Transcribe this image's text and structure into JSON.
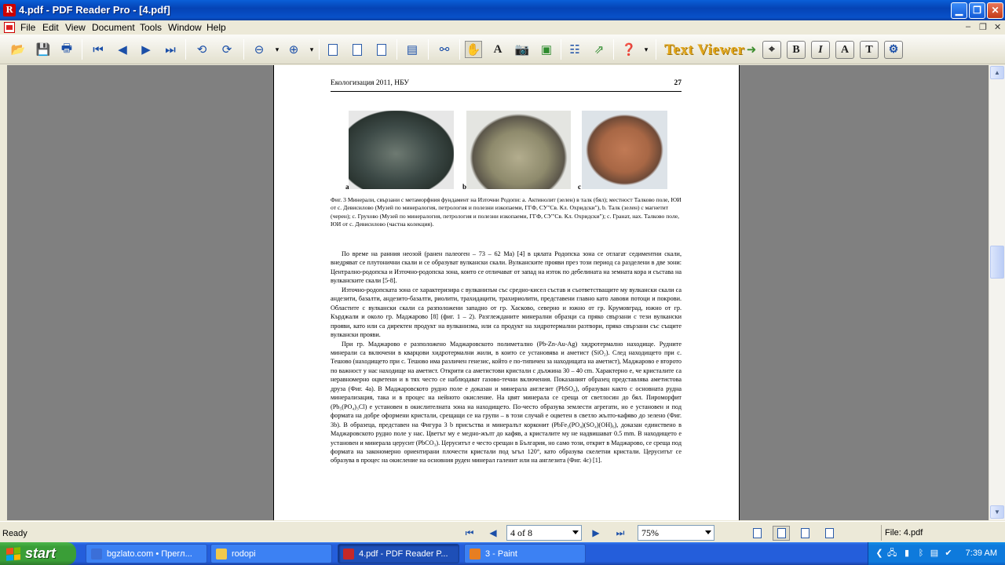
{
  "window": {
    "title": "4.pdf - PDF Reader Pro - [4.pdf]",
    "app_icon_glyph": "R"
  },
  "menu": {
    "items": [
      "File",
      "Edit",
      "View",
      "Document",
      "Tools",
      "Window",
      "Help"
    ],
    "mdi_controls": [
      "–",
      "❐",
      "✕"
    ]
  },
  "toolbar": {
    "text_viewer_label": "Text Viewer",
    "format_buttons": [
      "B",
      "I",
      "A",
      "T"
    ]
  },
  "document": {
    "header_left": "Екологизация 2011, НБУ",
    "header_page": "27",
    "photo_labels": [
      "a",
      "b",
      "c"
    ],
    "caption": "Фиг. 3 Минерали, свързани с метаморфния фундамент на Източни Родопи: а. Актинолит (зелен) в талк (бял); местност Талково поле, ЮИ от с. Девисилово (Музей по минералогия, петрология и полезни изкопаеми, ГГФ, СУ\"Св. Кл. Охридски\"), b. Талк (зелен) с магнетит (черен); с. Грухово (Музей по минералогия, петрология и полезни изкопаеми, ГГФ, СУ\"Св. Кл. Охридски\"); с. Гранат, нах. Талково поле, ЮИ от с. Девисилово (частна колекция).",
    "paragraphs": [
      "По време на ранния неозой (ранен палеоген – 73 – 62 Ма) [4] в цялата Родопска зона се отлагат седиментни скали, внедряват се плутонични скали и се образуват вулкански скали. Вулканските прояви през този период са разделени в две зони: Централно-родопска и Източно-родопска зона, които се отличават от запад на изток по дебелината на земната кора и състава на вулканските скали [5-8].",
      "Източно-родопската зона се характеризира с вулканизъм със средно-кисел състав и съответстващите му вулкански скали са андезити, базалти, андезито-базалти, риолити, трахидацити, трахириолити, представени главно като лавови потоци и покрови. Областите с вулкански скали са разположени западно от гр. Хасково, северно и южно от гр. Крумовград, южно от гр. Кърджали и около гр. Маджарово [8] (фиг. 1 – 2). Разглежданите минерални образци са пряко свързани с тези вулкански прояви, като или са директен продукт на вулканизма, или са продукт на хидротермални разтвори, пряко свързани със същите вулкански прояви.",
      "При гр. Маджарово е разположено Маджаровското полиметално (Pb-Zn-Au-Ag) хидротермално находище. Рудните минерали са включени в кварцови хидротермални жили, в които се установява и аметист (SiO₂). След находището при с. Тешово (находището при с. Тешово има различен генезис, който е по-типичен за находищата на аметист), Маджарово е второто по важност у нас находище на аметист. Открити са аметистови кристали с дължина 30 – 40 cm. Характерно е, че кристалите са неравномерно оцветени и в тях често се наблюдават газово-течни включения. Показаният образец представлява аметистова друза (Фиг. 4а). В Маджаровското рудно поле е доказан и минерала англезит (PbSO₄), образуван както с основната рудна минерализация, така и в процес на нейното окисление. На цвят минерала се среща от светлосин до бял. Пироморфит (Pb₅(PO₄)₃Cl) е установен в окислителната зона на находището. По-често образува землести агрегати, но е установен и под формата на добре оформени кристали, срещащи се на групи – в този случай е оцветен в светло жълто-кафяво до зелено (Фиг. 3b). В образеца, представен на Фигура 3 b присъства и минералът корконит (PbFe₃(PO₄)(SO₄)(OH)₆), доказан единствено в Маджаровското рудно поле у нас. Цветът му е медно-жълт до кафяв, а кристалите му не надвишават 0.5 mm. В находището е установен и минерала церусит (PbCO₃). Церуситът е често срещан в България, но само този, открит в Маджарово, се среща под формата на закономерно ориентирани плочести кристали под ъгъл 120°, като образува скелетни кристали. Церуситът се образува в процес на окисление на основния руден минерал галенит или на англезита (Фиг. 4c) [1]."
    ]
  },
  "status": {
    "ready": "Ready",
    "page_indicator": "4 of 8",
    "zoom": "75%",
    "file_label": "File: 4.pdf"
  },
  "taskbar": {
    "start_label": "start",
    "tasks": [
      {
        "label": "bgzlato.com • Прегл...",
        "color": "#3B6FD8",
        "active": false
      },
      {
        "label": "rodopi",
        "color": "#F2C94C",
        "active": false
      },
      {
        "label": "4.pdf - PDF Reader P...",
        "color": "#C62828",
        "active": true
      },
      {
        "label": "3 - Paint",
        "color": "#E67E22",
        "active": false
      }
    ],
    "clock": "7:39 AM"
  }
}
